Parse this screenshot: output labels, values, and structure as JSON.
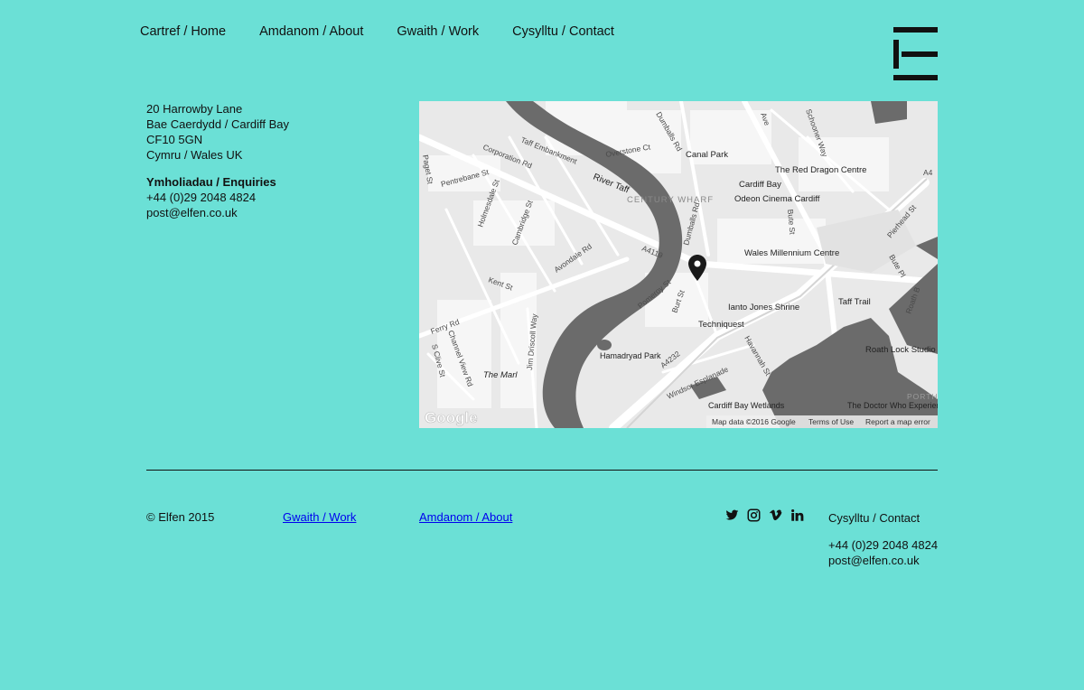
{
  "nav": {
    "items": [
      {
        "label": "Cartref / Home"
      },
      {
        "label": "Amdanom / About"
      },
      {
        "label": "Gwaith / Work"
      },
      {
        "label": "Cysylltu / Contact"
      }
    ]
  },
  "logo": {
    "letter": "E",
    "icon": "elfen-logo"
  },
  "address": {
    "line1": "20 Harrowby Lane",
    "line2": "Bae Caerdydd / Cardiff Bay",
    "line3": "CF10 5GN",
    "line4": "Cymru / Wales UK",
    "enquiries_heading": "Ymholiadau / Enquiries",
    "phone": "+44 (0)29 2048 4824",
    "email": "post@elfen.co.uk"
  },
  "map": {
    "labels": {
      "river_taff": "River Taff",
      "century_wharf": "CENTURY WHARF",
      "canal_park": "Canal Park",
      "red_dragon": "The Red Dragon Centre",
      "cardiff_bay": "Cardiff Bay",
      "odeon": "Odeon Cinema Cardiff",
      "wmc": "Wales Millennium Centre",
      "ianto": "Ianto Jones Shrine",
      "taff_trail": "Taff Trail",
      "techniquest": "Techniquest",
      "roath_lock": "Roath Lock Studio",
      "doctor_who": "The Doctor Who Experience",
      "hamadryad": "Hamadryad Park",
      "the_marl": "The Marl",
      "wetlands": "Cardiff Bay Wetlands",
      "a4232": "A4232",
      "a4119": "A4119",
      "avondale": "Avondale Rd",
      "ferry": "Ferry Rd",
      "kent": "Kent St",
      "pomeroy": "Pomeroy St",
      "burt": "Burt St",
      "windsor": "Windsor Esplanade",
      "havannah": "Havannah St",
      "dumballs": "Dumballs Rd",
      "corporation": "Corporation Rd",
      "taff_emb": "Taff Embankment",
      "holmesdale": "Holmesdale St",
      "cambridge": "Cambridge St",
      "pentrebane": "Pentrebane St",
      "paget": "Paget St",
      "overstone": "Overstone Ct",
      "jim_driscoll": "Jim Driscoll Way",
      "channel_view": "Channel View Rd",
      "s_clive": "S Clive St",
      "bute_st": "Bute St",
      "bute_pl": "Bute Pl",
      "pierhead": "Pierhead St",
      "schooner": "Schooner Way",
      "roath_b": "Roath B",
      "porth": "PORTH",
      "a4": "A4",
      "ave": "Ave"
    },
    "google": "Google",
    "attribution": "Map data ©2016 Google",
    "terms": "Terms of Use",
    "report": "Report a map error"
  },
  "footer": {
    "copyright": "© Elfen 2015",
    "work": "Gwaith / Work",
    "about": "Amdanom / About",
    "contact": "Cysylltu / Contact",
    "phone": "+44 (0)29 2048 4824",
    "email": "post@elfen.co.uk",
    "social": [
      "twitter-icon",
      "instagram-icon",
      "vimeo-icon",
      "linkedin-icon"
    ]
  },
  "colors": {
    "background": "#6be0d6",
    "text": "#111111"
  }
}
